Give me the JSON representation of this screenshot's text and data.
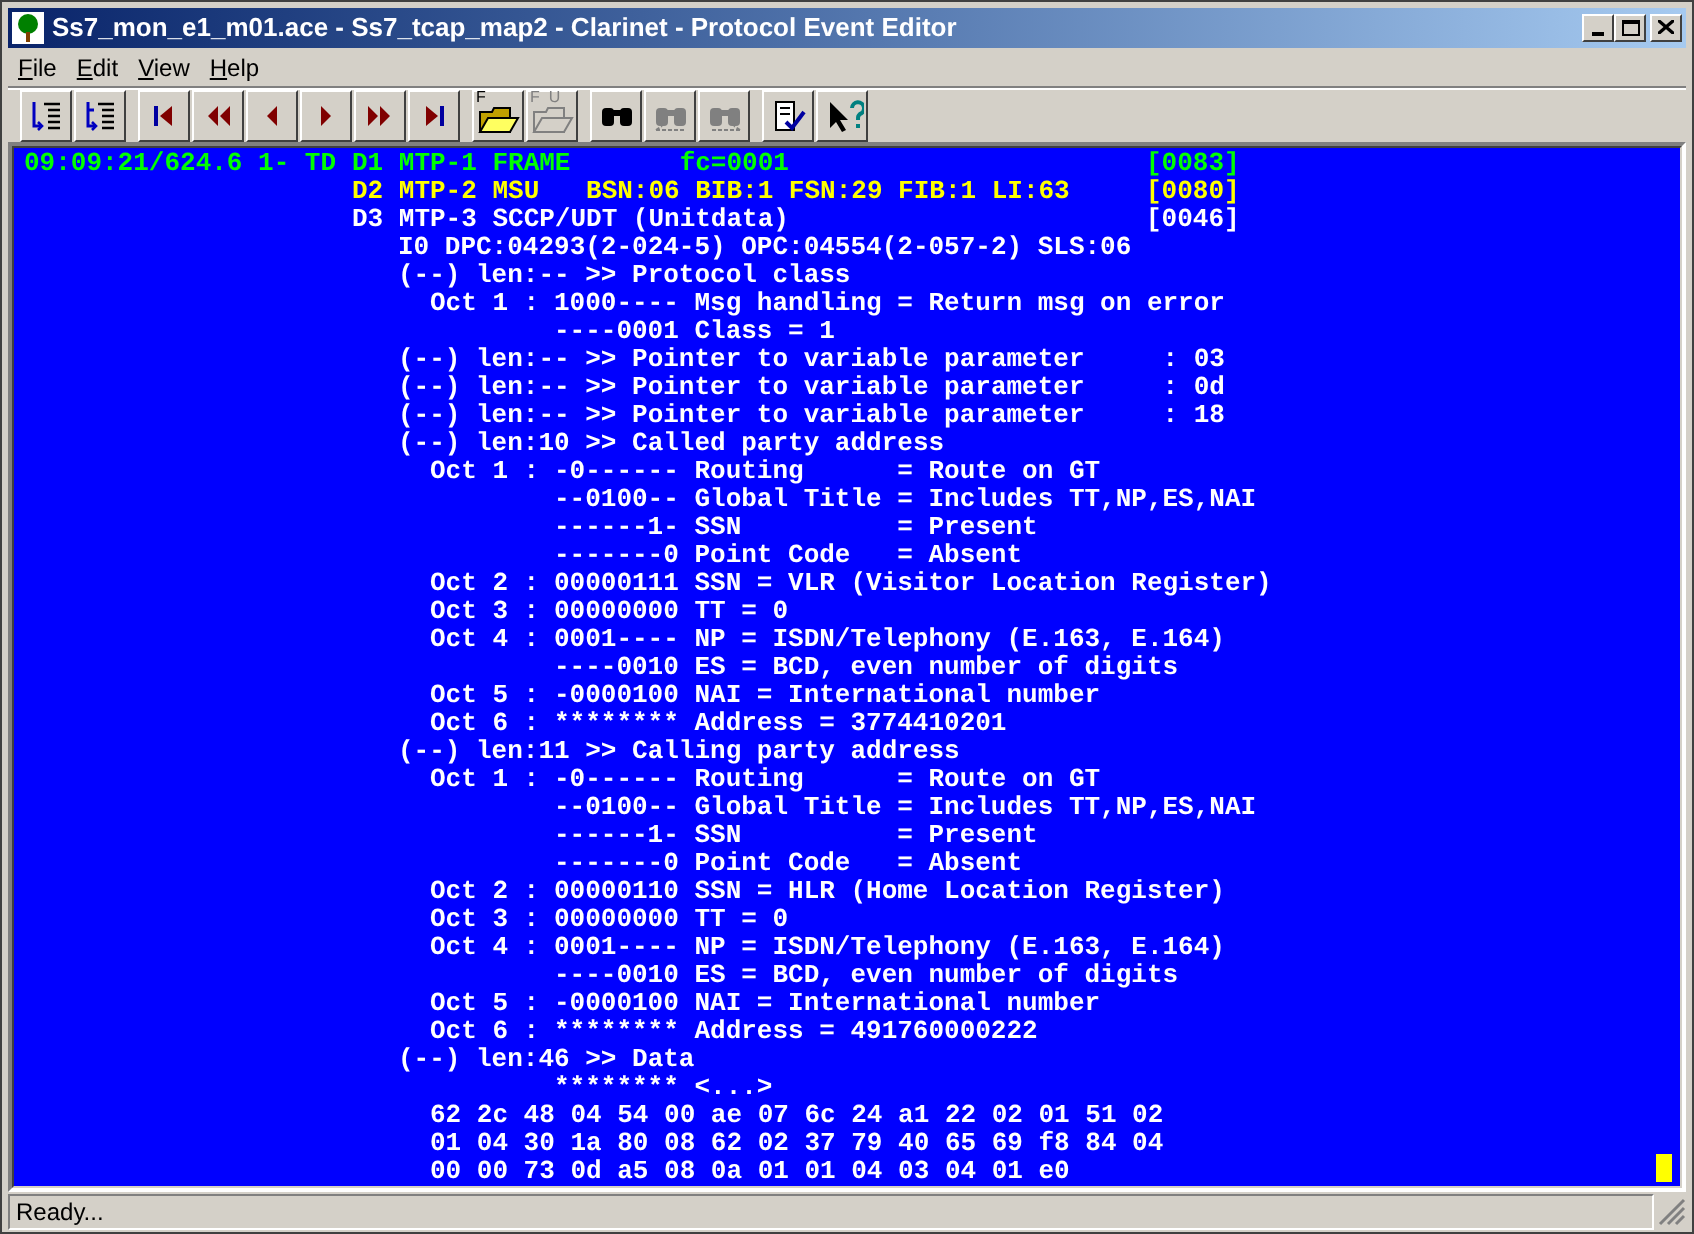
{
  "window": {
    "title": "Ss7_mon_e1_m01.ace - Ss7_tcap_map2 - Clarinet - Protocol Event Editor"
  },
  "menu": [
    {
      "label": "File"
    },
    {
      "label": "Edit"
    },
    {
      "label": "View"
    },
    {
      "label": "Help"
    }
  ],
  "toolbar": [
    [
      {
        "kind": "expand",
        "disabled": false
      },
      {
        "kind": "collapse",
        "disabled": false
      }
    ],
    [
      {
        "kind": "first",
        "disabled": false
      },
      {
        "kind": "fast-back",
        "disabled": false
      },
      {
        "kind": "back",
        "disabled": false
      },
      {
        "kind": "forward",
        "disabled": false
      },
      {
        "kind": "fast-forward",
        "disabled": false
      },
      {
        "kind": "last",
        "disabled": false
      }
    ],
    [
      {
        "kind": "folder",
        "disabled": false,
        "label": "F"
      },
      {
        "kind": "folder",
        "disabled": true,
        "label": "F  U"
      }
    ],
    [
      {
        "kind": "find",
        "disabled": false
      },
      {
        "kind": "find-back",
        "disabled": true
      },
      {
        "kind": "find-next",
        "disabled": true
      }
    ],
    [
      {
        "kind": "check",
        "disabled": false
      },
      {
        "kind": "help",
        "disabled": false
      }
    ]
  ],
  "trace": {
    "headers": [
      {
        "prefix": "09:09:21/624.6 1- TD",
        "text": "D1 MTP-1 FRAME       fc=0001",
        "tag": "[0083]",
        "color": "#00ff00"
      },
      {
        "text": "D2 MTP-2 MSU   BSN:06 BIB:1 FSN:29 FIB:1 LI:63",
        "tag": "[0080]",
        "color": "#ffff00"
      },
      {
        "text": "D3 MTP-3 SCCP/UDT (Unitdata)",
        "tag": "[0046]",
        "color": "#ffffff"
      }
    ],
    "address": "I0 DPC:04293(2-024-5) OPC:04554(2-057-2) SLS:06",
    "params": [
      {
        "head": "(--) len:-- >> Protocol class",
        "rows": [
          {
            "kind": "octet",
            "octet": "Oct 1 :",
            "text": "1000---- Msg handling = Return msg on error"
          },
          {
            "kind": "cont",
            "text": "----0001 Class = 1"
          }
        ]
      },
      {
        "head": "(--) len:-- >> Pointer to variable parameter     : 03"
      },
      {
        "head": "(--) len:-- >> Pointer to variable parameter     : 0d"
      },
      {
        "head": "(--) len:-- >> Pointer to variable parameter     : 18"
      },
      {
        "head": "(--) len:10 >> Called party address",
        "rows": [
          {
            "kind": "octet",
            "octet": "Oct 1 :",
            "text": "-0------ Routing      = Route on GT"
          },
          {
            "kind": "cont",
            "text": "--0100-- Global Title = Includes TT,NP,ES,NAI"
          },
          {
            "kind": "cont",
            "text": "------1- SSN          = Present"
          },
          {
            "kind": "cont",
            "text": "-------0 Point Code   = Absent"
          },
          {
            "kind": "octet",
            "octet": "Oct 2 :",
            "text": "00000111 SSN = VLR (Visitor Location Register)"
          },
          {
            "kind": "octet",
            "octet": "Oct 3 :",
            "text": "00000000 TT = 0"
          },
          {
            "kind": "octet",
            "octet": "Oct 4 :",
            "text": "0001---- NP = ISDN/Telephony (E.163, E.164)"
          },
          {
            "kind": "cont",
            "text": "----0010 ES = BCD, even number of digits"
          },
          {
            "kind": "octet",
            "octet": "Oct 5 :",
            "text": "-0000100 NAI = International number"
          },
          {
            "kind": "octet",
            "octet": "Oct 6 :",
            "text": "******** Address = 3774410201"
          }
        ]
      },
      {
        "head": "(--) len:11 >> Calling party address",
        "rows": [
          {
            "kind": "octet",
            "octet": "Oct 1 :",
            "text": "-0------ Routing      = Route on GT"
          },
          {
            "kind": "cont",
            "text": "--0100-- Global Title = Includes TT,NP,ES,NAI"
          },
          {
            "kind": "cont",
            "text": "------1- SSN          = Present"
          },
          {
            "kind": "cont",
            "text": "-------0 Point Code   = Absent"
          },
          {
            "kind": "octet",
            "octet": "Oct 2 :",
            "text": "00000110 SSN = HLR (Home Location Register)"
          },
          {
            "kind": "octet",
            "octet": "Oct 3 :",
            "text": "00000000 TT = 0"
          },
          {
            "kind": "octet",
            "octet": "Oct 4 :",
            "text": "0001---- NP = ISDN/Telephony (E.163, E.164)"
          },
          {
            "kind": "cont",
            "text": "----0010 ES = BCD, even number of digits"
          },
          {
            "kind": "octet",
            "octet": "Oct 5 :",
            "text": "-0000100 NAI = International number"
          },
          {
            "kind": "octet",
            "octet": "Oct 6 :",
            "text": "******** Address = 491760000222"
          }
        ]
      },
      {
        "head": "(--) len:46 >> Data",
        "rows": [
          {
            "kind": "cont",
            "text": "******** <...>"
          },
          {
            "kind": "hex",
            "text": "62 2c 48 04 54 00 ae 07 6c 24 a1 22 02 01 51 02"
          },
          {
            "kind": "hex",
            "text": "01 04 30 1a 80 08 62 02 37 79 40 65 69 f8 84 04"
          },
          {
            "kind": "hex",
            "text": "00 00 73 0d a5 08 0a 01 01 04 03 04 01 e0"
          }
        ]
      }
    ]
  },
  "status_bar": {
    "text": "Ready..."
  }
}
